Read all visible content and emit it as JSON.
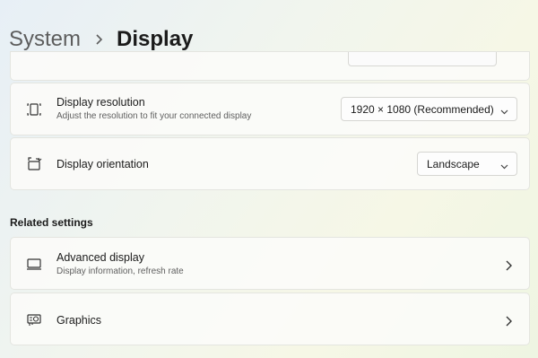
{
  "breadcrumb": {
    "parent": "System",
    "separator_icon": "chevron-right-icon",
    "current": "Display"
  },
  "display_settings": {
    "resolution": {
      "title": "Display resolution",
      "description": "Adjust the resolution to fit your connected display",
      "icon": "resolution-icon",
      "value": "1920 × 1080 (Recommended)"
    },
    "orientation": {
      "title": "Display orientation",
      "icon": "orientation-icon",
      "value": "Landscape"
    }
  },
  "related_settings": {
    "heading": "Related settings",
    "items": [
      {
        "title": "Advanced display",
        "description": "Display information, refresh rate",
        "icon": "monitor-icon"
      },
      {
        "title": "Graphics",
        "icon": "graphics-card-icon"
      }
    ]
  }
}
